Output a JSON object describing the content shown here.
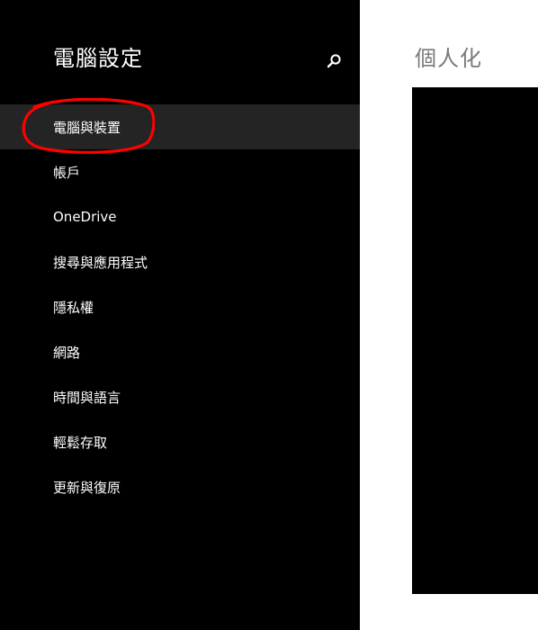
{
  "sidebar": {
    "title": "電腦設定",
    "search_icon": "search-icon",
    "items": [
      {
        "label": "電腦與裝置",
        "selected": true
      },
      {
        "label": "帳戶",
        "selected": false
      },
      {
        "label": "OneDrive",
        "selected": false
      },
      {
        "label": "搜尋與應用程式",
        "selected": false
      },
      {
        "label": "隱私權",
        "selected": false
      },
      {
        "label": "網路",
        "selected": false
      },
      {
        "label": "時間與語言",
        "selected": false
      },
      {
        "label": "輕鬆存取",
        "selected": false
      },
      {
        "label": "更新與復原",
        "selected": false
      }
    ]
  },
  "main": {
    "title": "個人化"
  },
  "colors": {
    "sidebar_bg": "#000000",
    "selected_bg": "#242424",
    "annotation": "#ff0000",
    "main_bg": "#ffffff",
    "main_title": "#7a7a7a"
  }
}
